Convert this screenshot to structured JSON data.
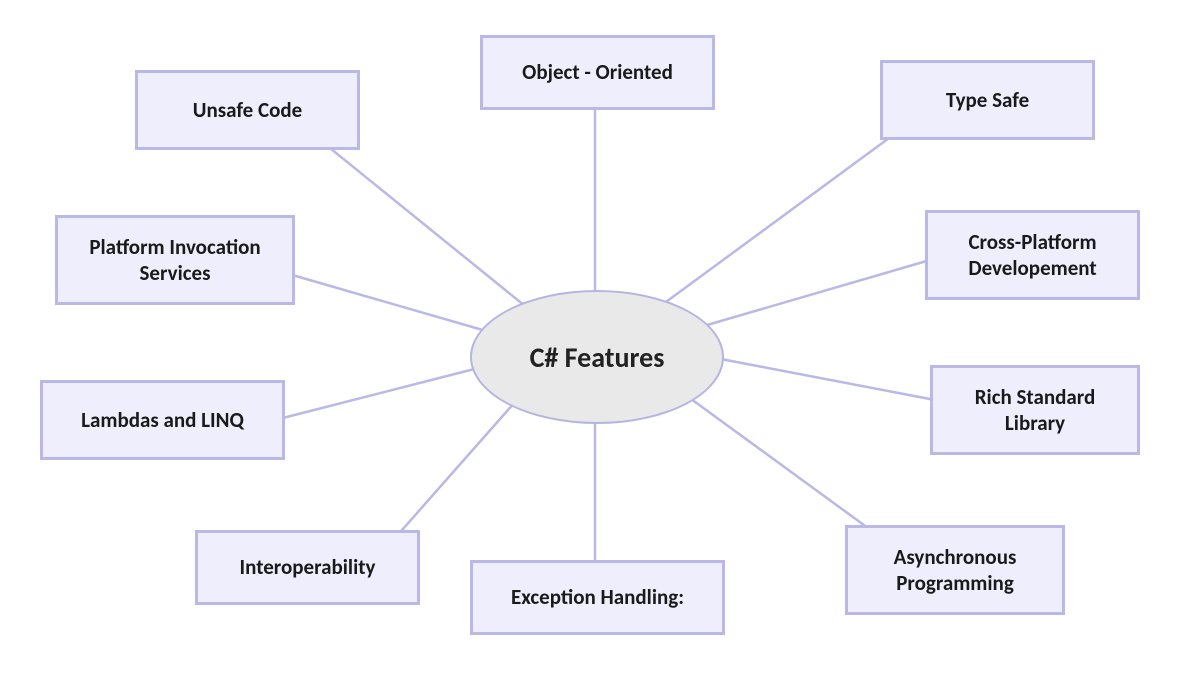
{
  "diagram": {
    "center_label": "C# Features",
    "nodes": {
      "object_oriented": "Object - Oriented",
      "type_safe": "Type Safe",
      "cross_platform": "Cross-Platform Developement",
      "rich_library": "Rich Standard Library",
      "async_programming": "Asynchronous Programming",
      "exception_handling": "Exception Handling:",
      "interoperability": "Interoperability",
      "lambdas_linq": "Lambdas and LINQ",
      "platform_invocation": "Platform Invocation Services",
      "unsafe_code": "Unsafe Code"
    }
  }
}
